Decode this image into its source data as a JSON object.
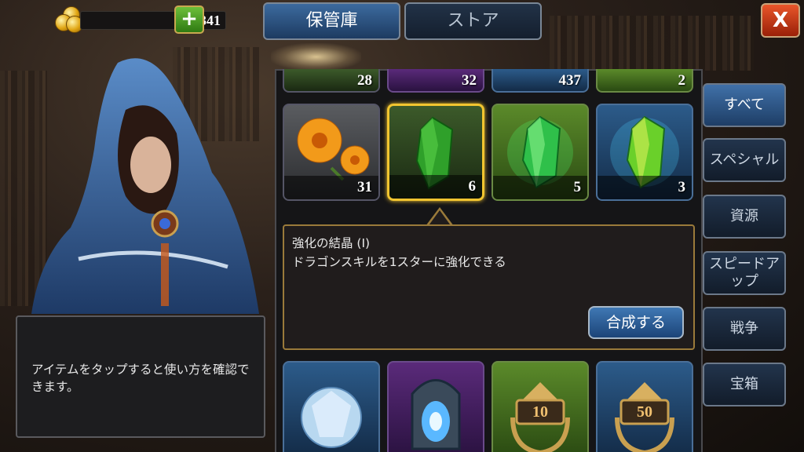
{
  "currency": {
    "coins": "97341",
    "add_label": "+"
  },
  "tabs": [
    {
      "label": "保管庫",
      "active": true
    },
    {
      "label": "ストア",
      "active": false
    }
  ],
  "close_label": "X",
  "hint": {
    "text": "アイテムをタップすると使い方を確認できます。"
  },
  "top_row_counts": [
    "28",
    "32",
    "437",
    "2"
  ],
  "items_row": [
    {
      "icon": "marigold-flower-icon",
      "count": "31"
    },
    {
      "icon": "green-crystal-icon",
      "count": "6",
      "selected": true
    },
    {
      "icon": "green-crystal-glowing-icon",
      "count": "5"
    },
    {
      "icon": "blue-green-crystal-icon",
      "count": "3"
    }
  ],
  "bottom_row": [
    {
      "icon": "diamond-icon"
    },
    {
      "icon": "portal-icon"
    },
    {
      "icon": "laurel-badge-icon",
      "label": "10"
    },
    {
      "icon": "laurel-badge-icon",
      "label": "50"
    }
  ],
  "description": {
    "title": "強化の結晶 (I)",
    "body": "ドラゴンスキルを1スターに強化できる",
    "craft_label": "合成する"
  },
  "categories": [
    {
      "label": "すべて",
      "active": true
    },
    {
      "label": "スペシャル",
      "active": false
    },
    {
      "label": "資源",
      "active": false
    },
    {
      "label": "スピードアップ",
      "active": false
    },
    {
      "label": "戦争",
      "active": false
    },
    {
      "label": "宝箱",
      "active": false
    }
  ],
  "colors": {
    "accent_gold": "#f2c530",
    "button_blue": "#3f78b4",
    "close_red": "#e8562a",
    "add_green": "#6cbf3a"
  }
}
